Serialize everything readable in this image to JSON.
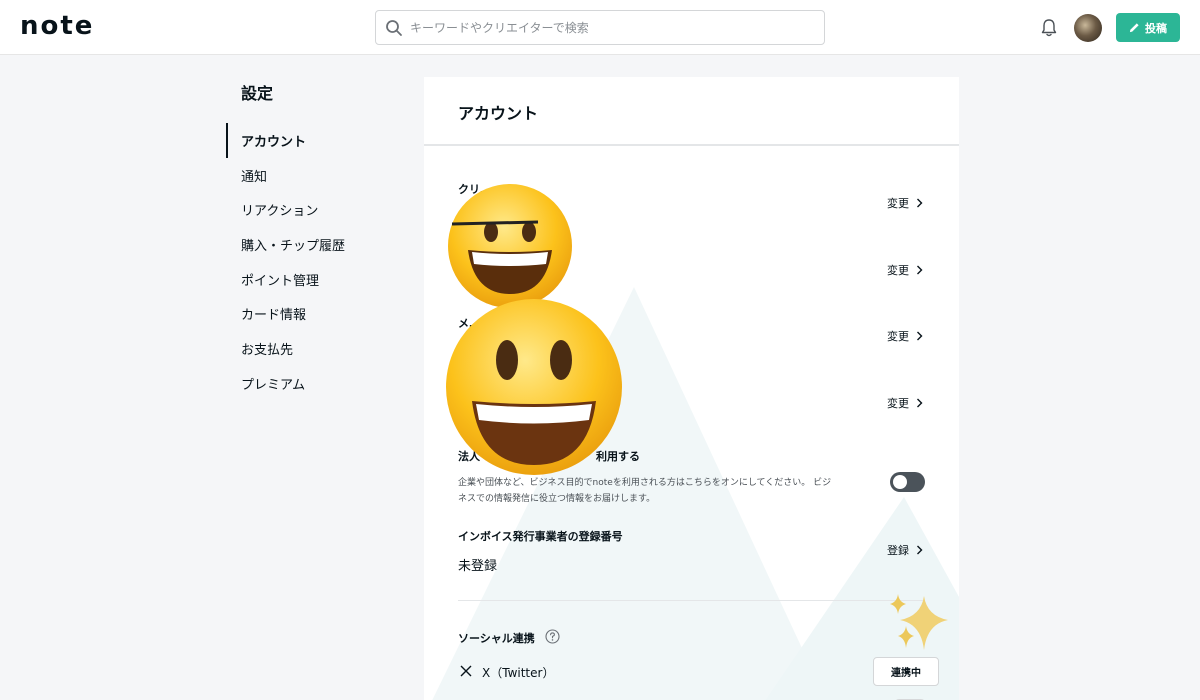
{
  "header": {
    "logo": "note",
    "search": {
      "placeholder": "キーワードやクリエイターで検索"
    },
    "post_label": "投稿",
    "accent": "#2cb696"
  },
  "sidebar": {
    "title": "設定",
    "items": [
      {
        "label": "アカウント",
        "active": true
      },
      {
        "label": "通知"
      },
      {
        "label": "リアクション"
      },
      {
        "label": "購入・チップ履歴"
      },
      {
        "label": "ポイント管理"
      },
      {
        "label": "カード情報"
      },
      {
        "label": "お支払先"
      },
      {
        "label": "プレミアム"
      }
    ]
  },
  "main": {
    "title": "アカウント",
    "rows": [
      {
        "label": "クリ…",
        "action": "変更"
      },
      {
        "label": "",
        "action": "変更"
      },
      {
        "label": "メ…",
        "action": "変更"
      },
      {
        "label": "",
        "action": "変更"
      }
    ],
    "business": {
      "label_prefix": "法人",
      "label_suffix": "利用する",
      "description": "企業や団体など、ビジネス目的でnoteを利用される方はこちらをオンにしてください。 ビジネスでの情報発信に役立つ情報をお届けします。",
      "toggle": "off"
    },
    "invoice": {
      "label": "インボイス発行事業者の登録番号",
      "value": "未登録",
      "action": "登録"
    },
    "social": {
      "label": "ソーシャル連携",
      "accounts": [
        {
          "name": "X（Twitter）",
          "status": "連携中"
        }
      ]
    }
  },
  "icons": [
    "search-icon",
    "bell-icon",
    "pencil-icon",
    "chevron-right-icon",
    "help-icon",
    "x-logo-icon"
  ],
  "decorations": [
    "grinning-face-emoji",
    "grinning-face-emoji",
    "sparkles-emoji"
  ]
}
